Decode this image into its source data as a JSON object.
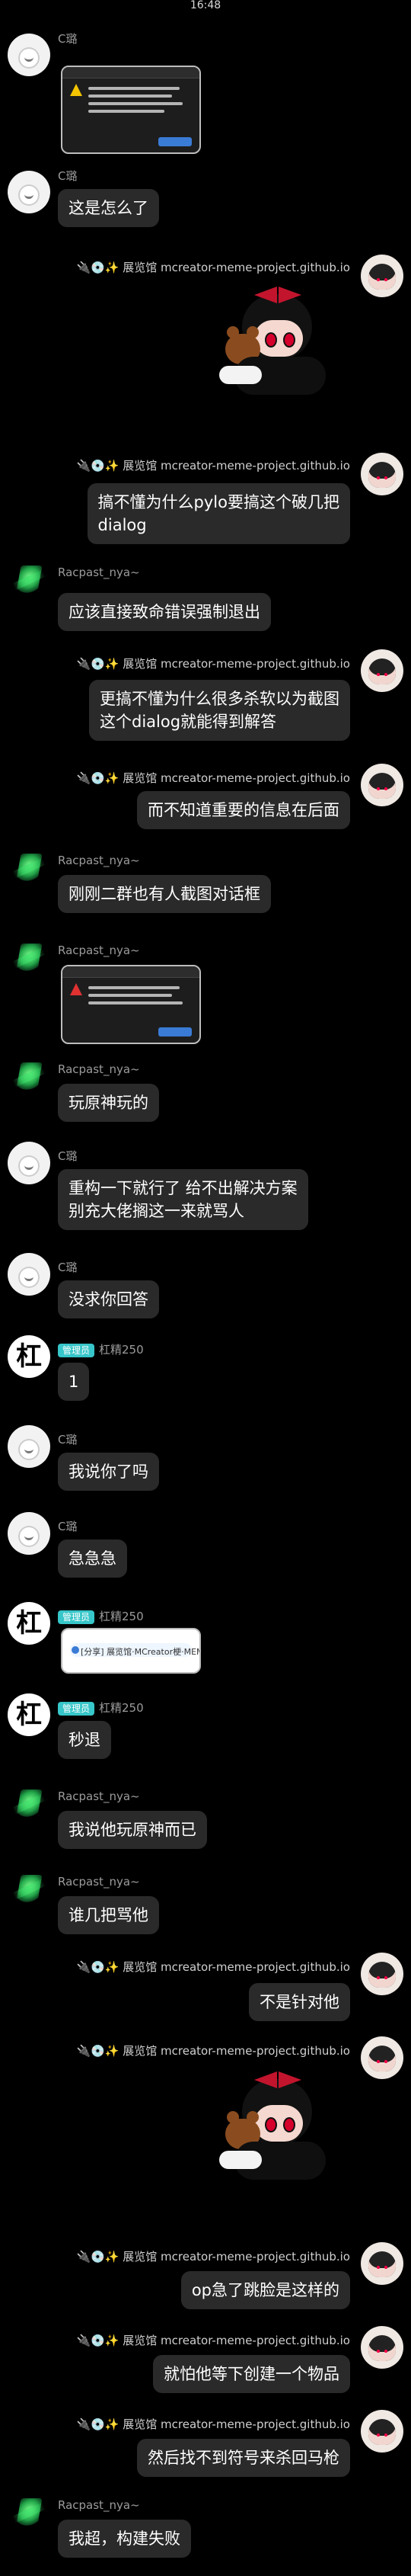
{
  "status": {
    "time": "16:48"
  },
  "users": {
    "c": "C璐",
    "rac": "Racpast_nya~",
    "gang": "杠精250",
    "me": "🔌💿✨ 展览馆 mcreator-meme-project.github.io"
  },
  "badges": {
    "admin": "管理员"
  },
  "messages": [
    {
      "id": "m1",
      "kind": "image",
      "side": "left",
      "sender": "c",
      "image": "dialog-screenshot-dark"
    },
    {
      "id": "m2",
      "kind": "text",
      "side": "left",
      "sender": "c",
      "text": "这是怎么了"
    },
    {
      "id": "m3",
      "kind": "sticker",
      "side": "right",
      "sender": "me",
      "sticker": "anime-girl-with-teddy"
    },
    {
      "id": "m4",
      "kind": "text",
      "side": "right",
      "sender": "me",
      "text": "搞不懂为什么pylo要搞这个破几把\ndialog"
    },
    {
      "id": "m5",
      "kind": "text",
      "side": "left",
      "sender": "rac",
      "text": "应该直接致命错误强制退出"
    },
    {
      "id": "m6",
      "kind": "text",
      "side": "right",
      "sender": "me",
      "text": "更搞不懂为什么很多杀软以为截图\n这个dialog就能得到解答"
    },
    {
      "id": "m7",
      "kind": "text",
      "side": "right",
      "sender": "me",
      "text": "而不知道重要的信息在后面"
    },
    {
      "id": "m8",
      "kind": "text",
      "side": "left",
      "sender": "rac",
      "text": "刚刚二群也有人截图对话框"
    },
    {
      "id": "m9",
      "kind": "image",
      "side": "left",
      "sender": "rac",
      "image": "dialog-screenshot-dark"
    },
    {
      "id": "m10",
      "kind": "text",
      "side": "left",
      "sender": "rac",
      "text": "玩原神玩的"
    },
    {
      "id": "m11",
      "kind": "text",
      "side": "left",
      "sender": "c",
      "text": "重构一下就行了 给不出解决方案\n别充大佬搁这一来就骂人"
    },
    {
      "id": "m12",
      "kind": "text",
      "side": "left",
      "sender": "c",
      "text": "没求你回答"
    },
    {
      "id": "m13",
      "kind": "text",
      "side": "left",
      "sender": "gang",
      "admin": true,
      "text": "1"
    },
    {
      "id": "m14",
      "kind": "text",
      "side": "left",
      "sender": "c",
      "text": "我说你了吗"
    },
    {
      "id": "m15",
      "kind": "text",
      "side": "left",
      "sender": "c",
      "text": "急急急"
    },
    {
      "id": "m16",
      "kind": "image",
      "side": "left",
      "sender": "gang",
      "admin": true,
      "image": "forwarded-link-white"
    },
    {
      "id": "m17",
      "kind": "text",
      "side": "left",
      "sender": "gang",
      "admin": true,
      "text": "秒退"
    },
    {
      "id": "m18",
      "kind": "text",
      "side": "left",
      "sender": "rac",
      "text": "我说他玩原神而已"
    },
    {
      "id": "m19",
      "kind": "text",
      "side": "left",
      "sender": "rac",
      "text": "谁几把骂他"
    },
    {
      "id": "m20",
      "kind": "text",
      "side": "right",
      "sender": "me",
      "text": "不是针对他"
    },
    {
      "id": "m21",
      "kind": "sticker",
      "side": "right",
      "sender": "me",
      "sticker": "anime-girl-with-teddy"
    },
    {
      "id": "m22",
      "kind": "text",
      "side": "right",
      "sender": "me",
      "text": "op急了跳脸是这样的"
    },
    {
      "id": "m23",
      "kind": "text",
      "side": "right",
      "sender": "me",
      "text": "就怕他等下创建一个物品"
    },
    {
      "id": "m24",
      "kind": "text",
      "side": "right",
      "sender": "me",
      "text": "然后找不到符号来杀回马枪"
    },
    {
      "id": "m25",
      "kind": "text",
      "side": "left",
      "sender": "rac",
      "text": "我超，构建失败"
    }
  ],
  "forwarded_preview": {
    "text": "[分享] 展览馆·MCreator梗·MEME"
  }
}
